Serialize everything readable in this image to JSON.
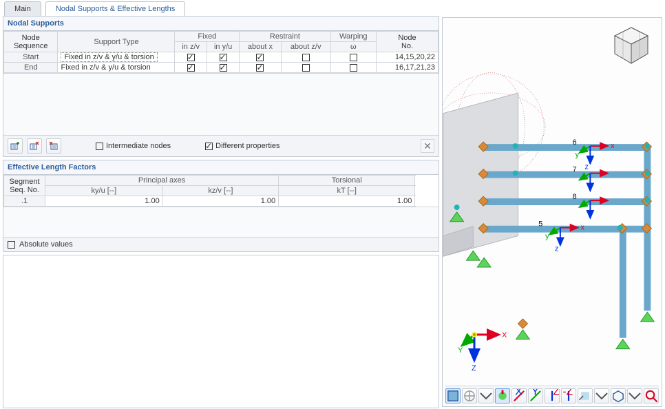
{
  "tabs": {
    "main": "Main",
    "nodal": "Nodal Supports & Effective Lengths"
  },
  "panel1": {
    "title": "Nodal Supports"
  },
  "table1": {
    "headers": {
      "nodeSeq1": "Node",
      "nodeSeq2": "Sequence",
      "supportType": "Support Type",
      "fixed": "Fixed",
      "inzv": "in z/v",
      "inyu": "in y/u",
      "restraint": "Restraint",
      "aboutx": "about x",
      "aboutzv": "about z/v",
      "warping": "Warping",
      "omega": "ω",
      "nodeNo1": "Node",
      "nodeNo2": "No."
    },
    "rows": [
      {
        "seq": "Start",
        "type": "Fixed in z/v & y/u & torsion",
        "zv": true,
        "yu": true,
        "ax": true,
        "azv": false,
        "w": false,
        "no": "14,15,20,22"
      },
      {
        "seq": "End",
        "type": "Fixed in z/v & y/u & torsion",
        "zv": true,
        "yu": true,
        "ax": true,
        "azv": false,
        "w": false,
        "no": "16,17,21,23"
      }
    ]
  },
  "options": {
    "intermediate": "Intermediate nodes",
    "different": "Different properties"
  },
  "panel2": {
    "title": "Effective Length Factors"
  },
  "table2": {
    "headers": {
      "seg1": "Segment",
      "seg2": "Seq. No.",
      "principal": "Principal axes",
      "kyu": "ky/u [--]",
      "kzv": "kz/v [--]",
      "torsional": "Torsional",
      "kt": "kT [--]"
    },
    "rows": [
      {
        "seg": ".1",
        "kyu": "1.00",
        "kzv": "1.00",
        "kt": "1.00"
      }
    ]
  },
  "absolute": "Absolute values",
  "axisLabels": {
    "x": "X",
    "y": "Y",
    "z": "Z"
  },
  "beamLabels": [
    "6",
    "7",
    "8",
    "5"
  ]
}
